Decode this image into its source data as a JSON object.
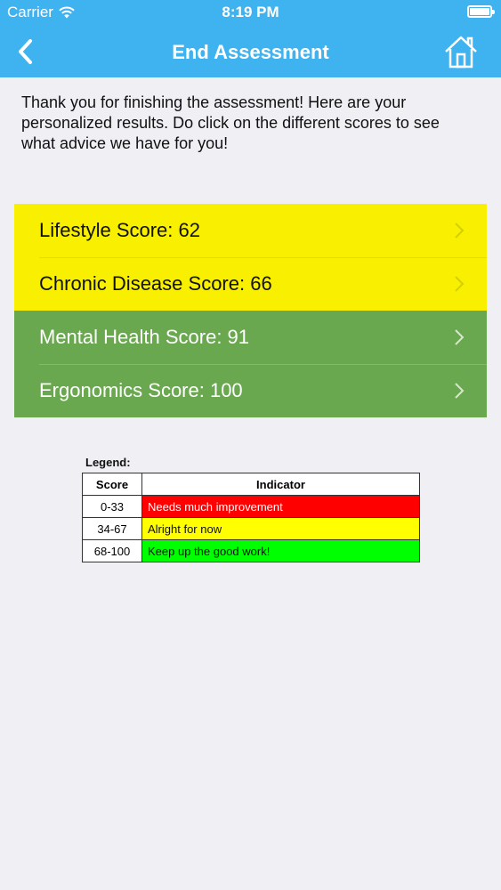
{
  "status_bar": {
    "carrier": "Carrier",
    "time": "8:19 PM"
  },
  "nav": {
    "title": "End Assessment"
  },
  "intro_text": "Thank you for finishing the assessment! Here are your personalized results. Do click on the different scores to see what advice we have for you!",
  "scores": [
    {
      "label": "Lifestyle Score: 62",
      "color": "#f8f000"
    },
    {
      "label": "Chronic Disease Score: 66",
      "color": "#f8f000"
    },
    {
      "label": "Mental Health Score: 91",
      "color": "#6aa84f"
    },
    {
      "label": "Ergonomics Score: 100",
      "color": "#6aa84f"
    }
  ],
  "legend": {
    "title": "Legend:",
    "headers": [
      "Score",
      "Indicator"
    ],
    "rows": [
      {
        "score": "0-33",
        "indicator": "Needs much improvement",
        "color": "#ff0000"
      },
      {
        "score": "34-67",
        "indicator": "Alright for now",
        "color": "#ffff00"
      },
      {
        "score": "68-100",
        "indicator": "Keep up the good work!",
        "color": "#00ff00"
      }
    ]
  },
  "colors": {
    "header": "#3fb2f0",
    "background": "#efeff4"
  }
}
